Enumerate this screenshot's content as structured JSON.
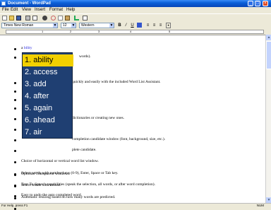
{
  "window": {
    "title": "Document - WordPad"
  },
  "menubar": {
    "items": [
      "File",
      "Edit",
      "View",
      "Insert",
      "Format",
      "Help"
    ]
  },
  "formatbar": {
    "font": "Times New Roman",
    "size": "12",
    "script": "Western",
    "bold": "B",
    "italic": "/",
    "underline": "U"
  },
  "ruler": {
    "labels": [
      "1",
      "2",
      "3",
      "4",
      "5"
    ]
  },
  "document": {
    "lines": [
      {
        "bullet": true,
        "pre": "a ",
        "blue": "bility",
        "post": ""
      },
      {
        "bullet": true,
        "text": "words)."
      },
      {
        "bullet": false,
        "text": ""
      },
      {
        "bullet": true,
        "text": "quickly and easily with the included Word List Assistant."
      },
      {
        "bullet": true,
        "text": ""
      },
      {
        "bullet": true,
        "text": ""
      },
      {
        "bullet": true,
        "text": ""
      },
      {
        "bullet": true,
        "text": "dictionaries or creating new ones."
      },
      {
        "bullet": true,
        "text": ""
      },
      {
        "bullet": true,
        "text": "completion candidate window (font, background, size, etc.)."
      },
      {
        "bullet": true,
        "text": "plete candidate."
      },
      {
        "bullet": true,
        "text": "Choice of horizontal or vertical word list window."
      },
      {
        "bullet": true,
        "text": "Select words with number keys (0-9), Enter, Space or Tab key."
      },
      {
        "bullet": true,
        "text": "Select words with mouse."
      },
      {
        "bullet": true,
        "text": "Automatic resizing based on how many words are predicted."
      },
      {
        "bullet": true,
        "text": "Optional Transparent windows."
      },
      {
        "bullet": true,
        "text": "Text-To-Speech capabilities (speak the selection, all words, or after word completion)."
      },
      {
        "bullet": true,
        "text": "Easy to undo the auto completed word."
      }
    ]
  },
  "candidates": {
    "items": [
      "1. ability",
      "2. access",
      "3. add",
      "4. after",
      "5. again",
      "6. ahead",
      "7. air"
    ],
    "selected_index": 0
  },
  "statusbar": {
    "help": "For Help, press F1",
    "mode": "NUM"
  },
  "colors": {
    "popup_bg": "#1F3F72",
    "highlight": "#F2D000",
    "link": "#2020E0"
  }
}
